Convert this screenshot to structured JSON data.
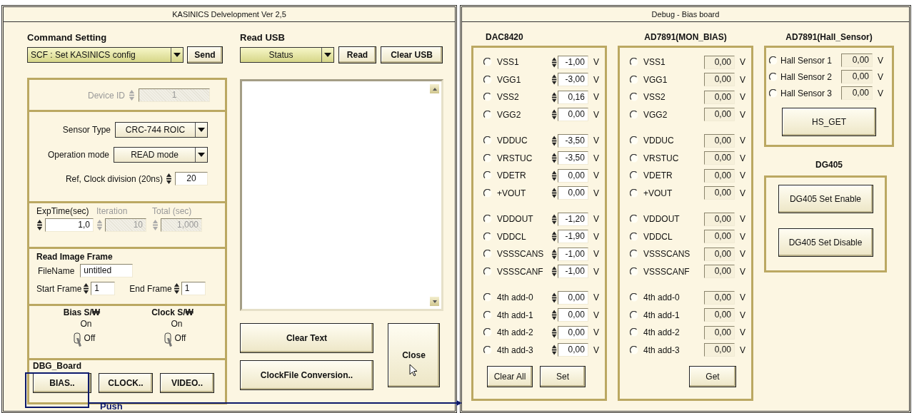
{
  "left_window": {
    "title": "KASINICS Delvelopment Ver 2,5",
    "command_setting": {
      "heading": "Command Setting",
      "value": "SCF :  Set KASINICS config",
      "button": "Send"
    },
    "device_id": {
      "label": "Device ID",
      "value": "1",
      "disabled": true
    },
    "sensor_type": {
      "label": "Sensor Type",
      "value": "CRC-744 ROIC"
    },
    "operation_mode": {
      "label": "Operation mode",
      "value": "READ  mode"
    },
    "clock_division": {
      "label": "Ref, Clock division (20ns)",
      "value": "20"
    },
    "exposure": [
      {
        "label": "ExpTime(sec)",
        "value": "1,0",
        "disabled": false
      },
      {
        "label": "Iteration",
        "value": "10",
        "disabled": true
      },
      {
        "label": "Total (sec)",
        "value": "1,000",
        "disabled": true
      }
    ],
    "read_image_frame": {
      "title": "Read Image Frame",
      "filename_label": "FileName",
      "filename": "untitled",
      "start_label": "Start Frame",
      "start": "1",
      "end_label": "End Frame",
      "end": "1"
    },
    "switches": [
      {
        "label": "Bias S/₩",
        "on_label": "On",
        "off_label": "Off",
        "on": false
      },
      {
        "label": "Clock S/₩",
        "on_label": "On",
        "off_label": "Off",
        "on": false
      }
    ],
    "dbg_board": {
      "title": "DBG_Board",
      "buttons": [
        "BIAS..",
        "CLOCK..",
        "VIDEO.."
      ]
    },
    "read_usb": {
      "heading": "Read USB",
      "value": "Status",
      "buttons": [
        "Read",
        "Clear USB"
      ]
    },
    "text_buttons": [
      "Clear Text",
      "ClockFile Conversion.."
    ],
    "close_button": "Close",
    "annotation": {
      "label": "Push"
    }
  },
  "right_window": {
    "title": "Debug - Bias board",
    "dac": {
      "title": "DAC8420",
      "groups": [
        {
          "rows": [
            {
              "label": "VSS1",
              "value": "-1,00",
              "unit": "V",
              "selected": false
            },
            {
              "label": "VGG1",
              "value": "-3,00",
              "unit": "V",
              "selected": false
            },
            {
              "label": "VSS2",
              "value": "0,16",
              "unit": "V",
              "selected": false
            },
            {
              "label": "VGG2",
              "value": "0,00",
              "unit": "V",
              "selected": false
            }
          ]
        },
        {
          "rows": [
            {
              "label": "VDDUC",
              "value": "-3,50",
              "unit": "V",
              "selected": false
            },
            {
              "label": "VRSTUC",
              "value": "-3,50",
              "unit": "V",
              "selected": false
            },
            {
              "label": "VDETR",
              "value": "0,00",
              "unit": "V",
              "selected": false
            },
            {
              "label": "+VOUT",
              "value": "0,00",
              "unit": "V",
              "selected": false
            }
          ]
        },
        {
          "rows": [
            {
              "label": "VDDOUT",
              "value": "-1,20",
              "unit": "V",
              "selected": false
            },
            {
              "label": "VDDCL",
              "value": "-1,90",
              "unit": "V",
              "selected": false
            },
            {
              "label": "VSSSCANS",
              "value": "-1,00",
              "unit": "V",
              "selected": false
            },
            {
              "label": "VSSSCANF",
              "value": "-1,00",
              "unit": "V",
              "selected": false
            }
          ]
        },
        {
          "rows": [
            {
              "label": "4th add-0",
              "value": "0,00",
              "unit": "V",
              "selected": false
            },
            {
              "label": "4th add-1",
              "value": "0,00",
              "unit": "V",
              "selected": false
            },
            {
              "label": "4th add-2",
              "value": "0,00",
              "unit": "V",
              "selected": false
            },
            {
              "label": "4th add-3",
              "value": "0,00",
              "unit": "V",
              "selected": false
            }
          ]
        }
      ],
      "buttons": [
        "Clear All",
        "Set"
      ]
    },
    "monitor": {
      "title": "AD7891(MON_BIAS)",
      "groups": [
        {
          "rows": [
            {
              "label": "VSS1",
              "value": "0,00",
              "unit": "V",
              "selected": false
            },
            {
              "label": "VGG1",
              "value": "0,00",
              "unit": "V",
              "selected": false
            },
            {
              "label": "VSS2",
              "value": "0,00",
              "unit": "V",
              "selected": false
            },
            {
              "label": "VGG2",
              "value": "0,00",
              "unit": "V",
              "selected": false
            }
          ]
        },
        {
          "rows": [
            {
              "label": "VDDUC",
              "value": "0,00",
              "unit": "V",
              "selected": false
            },
            {
              "label": "VRSTUC",
              "value": "0,00",
              "unit": "V",
              "selected": false
            },
            {
              "label": "VDETR",
              "value": "0,00",
              "unit": "V",
              "selected": false
            },
            {
              "label": "+VOUT",
              "value": "0,00",
              "unit": "V",
              "selected": false
            }
          ]
        },
        {
          "rows": [
            {
              "label": "VDDOUT",
              "value": "0,00",
              "unit": "V",
              "selected": false
            },
            {
              "label": "VDDCL",
              "value": "0,00",
              "unit": "V",
              "selected": false
            },
            {
              "label": "VSSSCANS",
              "value": "0,00",
              "unit": "V",
              "selected": false
            },
            {
              "label": "VSSSCANF",
              "value": "0,00",
              "unit": "V",
              "selected": false
            }
          ]
        },
        {
          "rows": [
            {
              "label": "4th add-0",
              "value": "0,00",
              "unit": "V",
              "selected": false
            },
            {
              "label": "4th add-1",
              "value": "0,00",
              "unit": "V",
              "selected": false
            },
            {
              "label": "4th add-2",
              "value": "0,00",
              "unit": "V",
              "selected": false
            },
            {
              "label": "4th add-3",
              "value": "0,00",
              "unit": "V",
              "selected": false
            }
          ]
        }
      ],
      "buttons": [
        "Get"
      ]
    },
    "hall": {
      "title": "AD7891(Hall_Sensor)",
      "rows": [
        {
          "label": "Hall Sensor 1",
          "value": "0,00",
          "unit": "V",
          "selected": false
        },
        {
          "label": "Hall Sensor 2",
          "value": "0,00",
          "unit": "V",
          "selected": false
        },
        {
          "label": "Hall Sensor 3",
          "value": "0,00",
          "unit": "V",
          "selected": false
        }
      ],
      "button": "HS_GET"
    },
    "dg405": {
      "title": "DG405",
      "buttons": [
        "DG405 Set Enable",
        "DG405 Set Disable"
      ]
    }
  }
}
